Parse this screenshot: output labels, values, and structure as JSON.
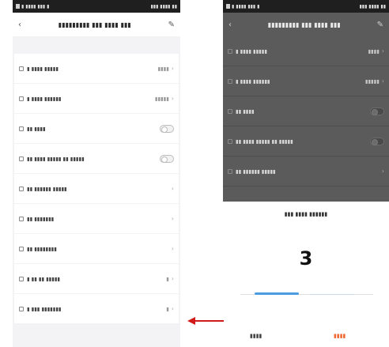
{
  "left_phone": {
    "statusbar": {
      "left": "▮ ▮▮▮▮ ▮▮▮ ▮",
      "right": "▮▮▮ ▮▮▮▮ ▮▮"
    },
    "header": {
      "back": "‹",
      "title": "▮▮▮▮▮▮▮▮▮ ▮▮▮ ▮▮▮▮ ▮▮▮",
      "edit": "✎"
    },
    "rows": [
      {
        "label": "▮ ▮▮▮▮ ▮▮▮▮▮",
        "value": "▮▮▮▮",
        "type": "value"
      },
      {
        "label": "▮ ▮▮▮▮ ▮▮▮▮▮▮",
        "value": "▮▮▮▮▮",
        "type": "value"
      },
      {
        "label": "▮▮ ▮▮▮▮",
        "value": "",
        "type": "toggle"
      },
      {
        "label": "▮▮ ▮▮▮▮ ▮▮▮▮▮ ▮▮ ▮▮▮▮▮",
        "value": "",
        "type": "toggle"
      },
      {
        "label": "▮▮ ▮▮▮▮▮▮ ▮▮▮▮▮",
        "value": "",
        "type": "chevron"
      },
      {
        "label": "▮▮ ▮▮▮▮▮▮▮",
        "value": "",
        "type": "chevron"
      },
      {
        "label": "▮▮ ▮▮▮▮▮▮▮▮",
        "value": "",
        "type": "chevron"
      },
      {
        "label": "▮ ▮▮ ▮▮ ▮▮▮▮▮",
        "value": "▮",
        "type": "value"
      },
      {
        "label": "▮ ▮▮▮ ▮▮▮▮▮▮▮",
        "value": "▮",
        "type": "value"
      }
    ]
  },
  "right_phone": {
    "statusbar": {
      "left": "▮ ▮▮▮▮ ▮▮▮ ▮",
      "right": "▮▮▮ ▮▮▮▮ ▮▮"
    },
    "header": {
      "back": "‹",
      "title": "▮▮▮▮▮▮▮▮▮ ▮▮▮ ▮▮▮▮ ▮▮▮",
      "edit": "✎"
    },
    "rows": [
      {
        "label": "▮ ▮▮▮▮ ▮▮▮▮▮",
        "value": "▮▮▮▮",
        "type": "value"
      },
      {
        "label": "▮ ▮▮▮▮ ▮▮▮▮▮▮",
        "value": "▮▮▮▮▮",
        "type": "value"
      },
      {
        "label": "▮▮ ▮▮▮▮",
        "value": "",
        "type": "toggle"
      },
      {
        "label": "▮▮ ▮▮▮▮ ▮▮▮▮▮ ▮▮ ▮▮▮▮▮",
        "value": "",
        "type": "toggle"
      },
      {
        "label": "▮▮ ▮▮▮▮▮▮ ▮▮▮▮▮",
        "value": "",
        "type": "chevron"
      }
    ],
    "sheet": {
      "title": "▮▮▮ ▮▮▮▮ ▮▮▮▮▮▮",
      "value": "3",
      "cancel": "▮▮▮▮",
      "confirm": "▮▮▮▮"
    }
  },
  "colors": {
    "accent": "#4a9be0",
    "confirm": "#f06a36",
    "arrow": "#d11a1a"
  }
}
